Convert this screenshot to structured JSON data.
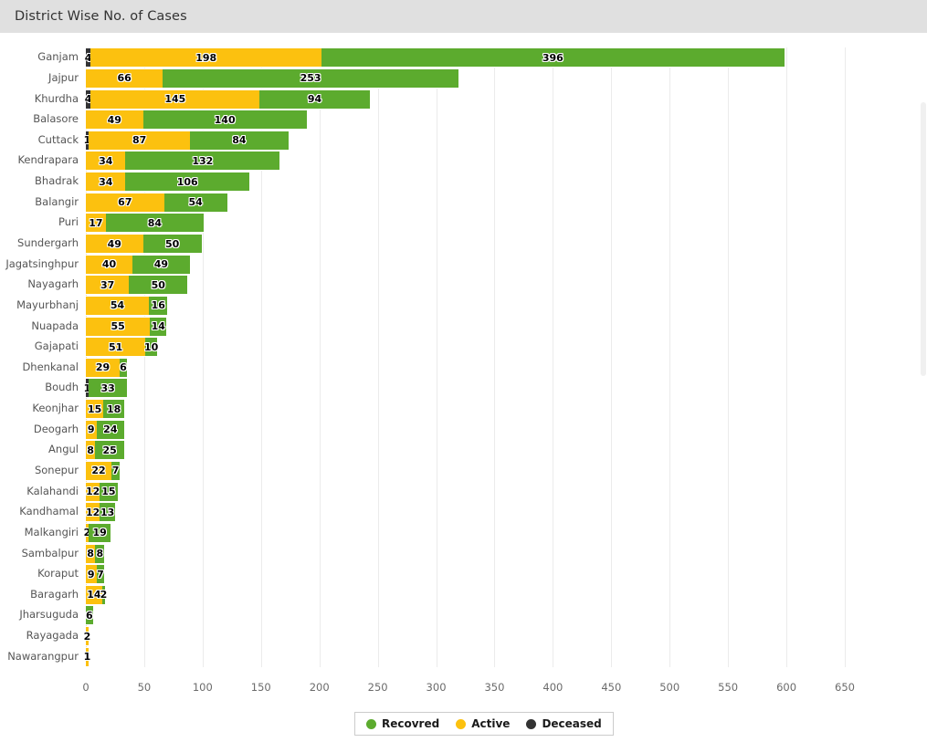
{
  "header": {
    "title": "District Wise No. of Cases",
    "background": "#e0e0e0"
  },
  "legend": {
    "items": [
      {
        "label": "Recovred",
        "color": "#5cab2e",
        "key": "recovered"
      },
      {
        "label": "Active",
        "color": "#fcc10f",
        "key": "active"
      },
      {
        "label": "Deceased",
        "color": "#333333",
        "key": "deceased"
      }
    ]
  },
  "colors": {
    "recovered": "#5cab2e",
    "active": "#fcc10f",
    "deceased": "#333333",
    "gridline": "#ebebeb",
    "axis_text": "#6b6b6b",
    "label_text": "#555555"
  },
  "chart_data": {
    "type": "bar",
    "orientation": "horizontal",
    "stacked": true,
    "title": "District Wise No. of Cases",
    "xlabel": "",
    "ylabel": "",
    "xlim": [
      0,
      650
    ],
    "xticks": [
      0,
      50,
      100,
      150,
      200,
      250,
      300,
      350,
      400,
      450,
      500,
      550,
      600,
      650
    ],
    "grid": true,
    "legend_position": "bottom",
    "categories": [
      "Ganjam",
      "Jajpur",
      "Khurdha",
      "Balasore",
      "Cuttack",
      "Kendrapara",
      "Bhadrak",
      "Balangir",
      "Puri",
      "Sundergarh",
      "Jagatsinghpur",
      "Nayagarh",
      "Mayurbhanj",
      "Nuapada",
      "Gajapati",
      "Dhenkanal",
      "Boudh",
      "Keonjhar",
      "Deogarh",
      "Angul",
      "Sonepur",
      "Kalahandi",
      "Kandhamal",
      "Malkangiri",
      "Sambalpur",
      "Koraput",
      "Baragarh",
      "Jharsuguda",
      "Rayagada",
      "Nawarangpur"
    ],
    "series": [
      {
        "name": "Deceased",
        "color": "#333333",
        "values": [
          4,
          0,
          4,
          0,
          1,
          0,
          0,
          0,
          0,
          0,
          0,
          0,
          0,
          0,
          0,
          0,
          1,
          0,
          0,
          0,
          0,
          0,
          0,
          0,
          0,
          0,
          0,
          0,
          0,
          0
        ]
      },
      {
        "name": "Active",
        "color": "#fcc10f",
        "values": [
          198,
          66,
          145,
          49,
          87,
          34,
          34,
          67,
          17,
          49,
          40,
          37,
          54,
          55,
          51,
          29,
          0,
          15,
          9,
          8,
          22,
          12,
          12,
          2,
          8,
          9,
          14,
          0,
          2,
          1
        ]
      },
      {
        "name": "Recovred",
        "color": "#5cab2e",
        "values": [
          396,
          253,
          94,
          140,
          84,
          132,
          106,
          54,
          84,
          50,
          49,
          50,
          16,
          14,
          10,
          6,
          33,
          18,
          24,
          25,
          7,
          15,
          13,
          19,
          8,
          7,
          2,
          6,
          0,
          0
        ]
      }
    ]
  }
}
